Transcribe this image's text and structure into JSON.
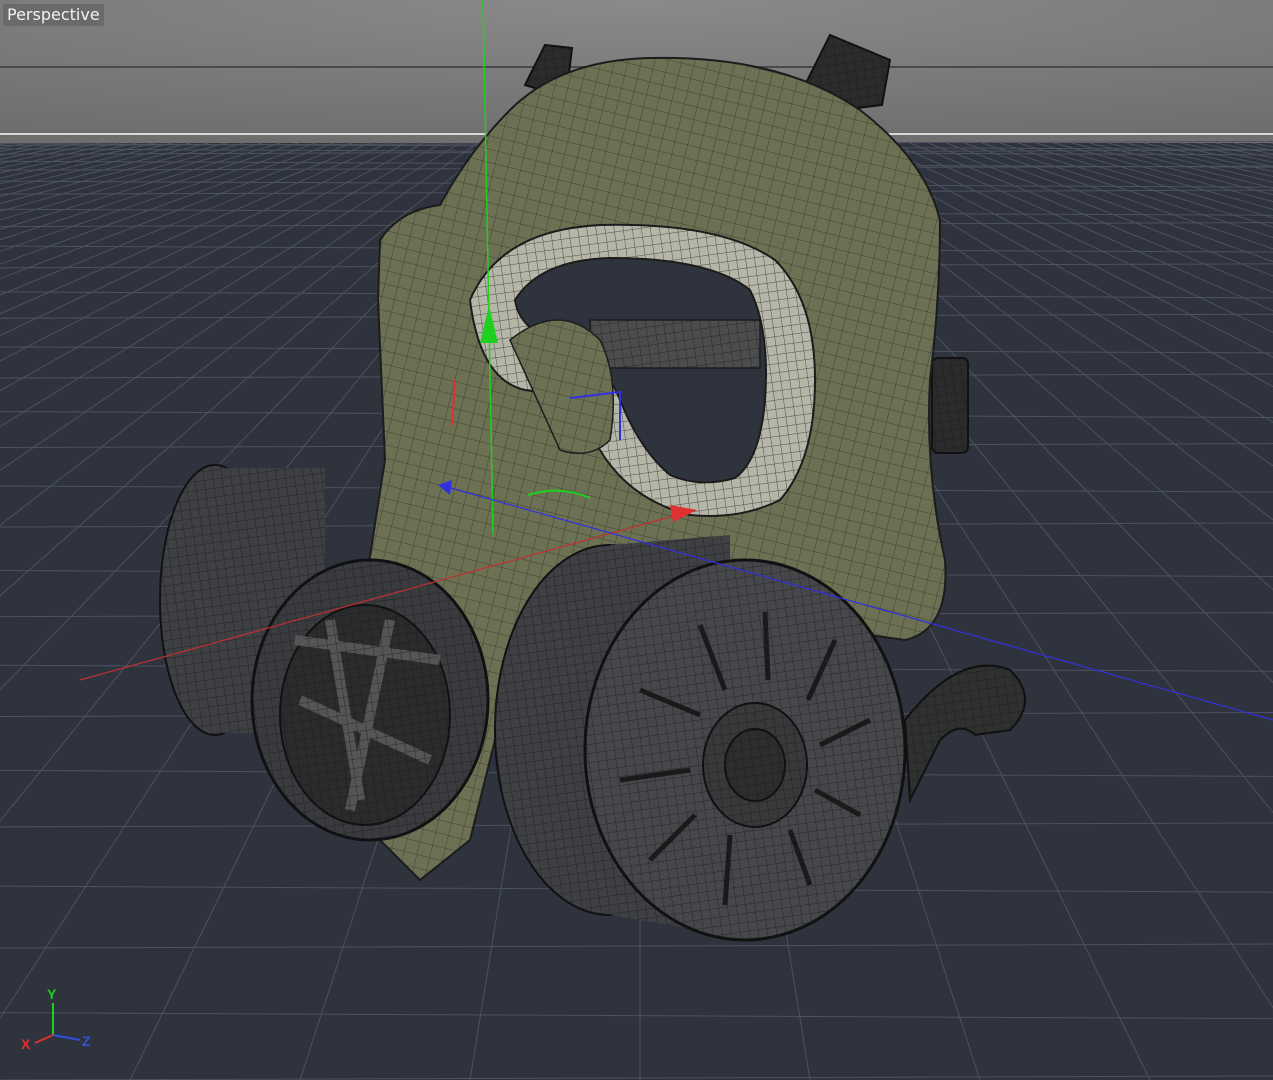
{
  "viewport": {
    "label": "Perspective",
    "background_color": "#2f333d",
    "sky_color": "#787878",
    "grid_color": "#4d5260"
  },
  "model": {
    "mask_color": "#6d7154",
    "filter_color": "#3f4043",
    "wire_color": "#1c1c1c"
  },
  "gizmo": {
    "x_color": "#e03030",
    "y_color": "#20d020",
    "z_color": "#3030e0"
  },
  "orientation_axes": {
    "x_label": "X",
    "y_label": "Y",
    "z_label": "Z"
  }
}
